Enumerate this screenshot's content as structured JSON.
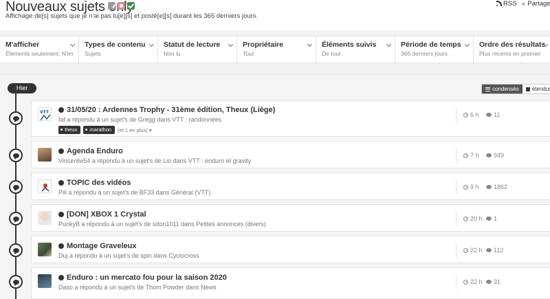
{
  "header": {
    "title": "Nouveaux sujets only",
    "subtitle": "Affichage de[s] sujets que je n'ai pas lu[e][s] et posté[e][s] durant les 365 derniers jours.",
    "rss": "RSS",
    "share": "Partager"
  },
  "filters": [
    {
      "label": "M'afficher",
      "value": "Éléments seulement; N'im…",
      "italic": false
    },
    {
      "label": "Types de contenu",
      "value": "Sujets",
      "italic": false
    },
    {
      "label": "Statut de lecture",
      "value": "Non lu",
      "italic": false
    },
    {
      "label": "Propriétaire",
      "value": "Tout",
      "italic": true
    },
    {
      "label": "Éléments suivis",
      "value": "De tout",
      "italic": true
    },
    {
      "label": "Période de temps",
      "value": "365 derniers jours",
      "italic": false
    },
    {
      "label": "Ordre des résultats",
      "value": "Plus récents en premier",
      "italic": false
    }
  ],
  "timeline": {
    "day_label": "Hier"
  },
  "view_toggle": {
    "condensed": "condensés",
    "expanded": "étendus"
  },
  "topics": [
    {
      "title": "31/05/20 : Ardennes Trophy - 31ème édition, Theux (Liège)",
      "sub": "faf a répondu à un sujet's de Gregg dans VTT : randonnées",
      "time": "6 h",
      "replies": "11",
      "tags": [
        "theux",
        "marathon"
      ],
      "tags_more": "(et 1 en plus)"
    },
    {
      "title": "Agenda Enduro",
      "sub": "Vincentw54 a répondu à un sujet's de Lio dans VTT : enduro et gravity",
      "time": "7 h",
      "replies": "949"
    },
    {
      "title": "TOPIC des vidéos",
      "sub": "Pili a répondu à un sujet's de BF33 dans Général (VTT)",
      "time": "9 h",
      "replies": "1862"
    },
    {
      "title": "[DON] XBOX 1 Crystal",
      "sub": "PunkyB a répondu à un sujet's de sdon1011 dans Petites annonces (divers)",
      "time": "20 h",
      "replies": "1"
    },
    {
      "title": "Montage Graveleux",
      "sub": "Duj a répondu à un sujet's de spin dans Cyclocross",
      "time": "22 h",
      "replies": "112"
    },
    {
      "title": "Enduro : un mercato fou pour la saison 2020",
      "sub": "Daso a répondu à un sujet's de Thom Powder dans News",
      "time": "22 h",
      "replies": "31"
    }
  ]
}
